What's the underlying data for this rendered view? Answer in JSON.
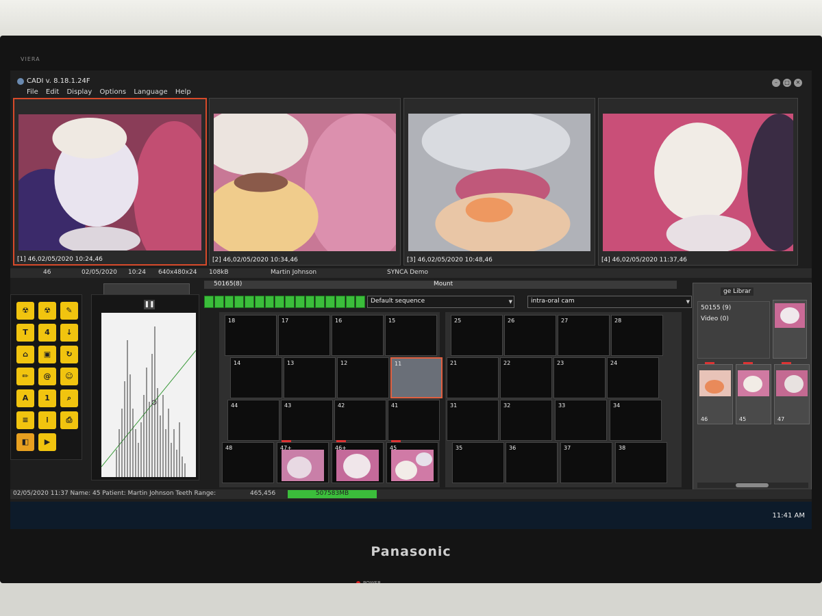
{
  "monitor": {
    "brand": "Panasonic",
    "brand_small": "VIERA",
    "power_label": "POWER"
  },
  "app": {
    "title": "CADI v. 8.18.1.24F"
  },
  "menu": [
    "File",
    "Edit",
    "Display",
    "Options",
    "Language",
    "Help"
  ],
  "images": [
    {
      "caption": "[1] 46,02/05/2020 10:24,46",
      "selected": true
    },
    {
      "caption": "[2] 46,02/05/2020 10:34,46",
      "selected": false
    },
    {
      "caption": "[3] 46,02/05/2020 10:48,46",
      "selected": false
    },
    {
      "caption": "[4] 46,02/05/2020 11:37,46",
      "selected": false
    }
  ],
  "info_bar": {
    "tooth": "46",
    "date": "02/05/2020",
    "time": "10:24",
    "resolution": "640x480x24",
    "size": "108kB",
    "patient": "Martin Johnson",
    "source": "SYNCA Demo"
  },
  "mount": {
    "id": "50165(8)",
    "title": "Mount",
    "sequence": "Default sequence",
    "camera": "intra-oral cam"
  },
  "quadrants": {
    "upper_right": [
      "18",
      "17",
      "16",
      "15",
      "14",
      "13",
      "12",
      "11"
    ],
    "upper_left": [
      "25",
      "26",
      "27",
      "28",
      "21",
      "22",
      "23",
      "24"
    ],
    "lower_right": [
      "44",
      "43",
      "42",
      "41",
      "48",
      "47+",
      "46+",
      "45"
    ],
    "lower_left": [
      "31",
      "32",
      "33",
      "34",
      "35",
      "36",
      "37",
      "38"
    ]
  },
  "right_panel": {
    "tab_label": "ge Librar",
    "record_id": "50155 (9)",
    "video": "Video (0)",
    "thumbs": [
      "46",
      "45",
      "47"
    ]
  },
  "status": {
    "text": "02/05/2020 11:37  Name: 45  Patient: Martin Johnson  Teeth Range:",
    "coords": "465,456",
    "memory": "507583MB"
  },
  "taskbar": {
    "clock": "11:41 AM"
  }
}
